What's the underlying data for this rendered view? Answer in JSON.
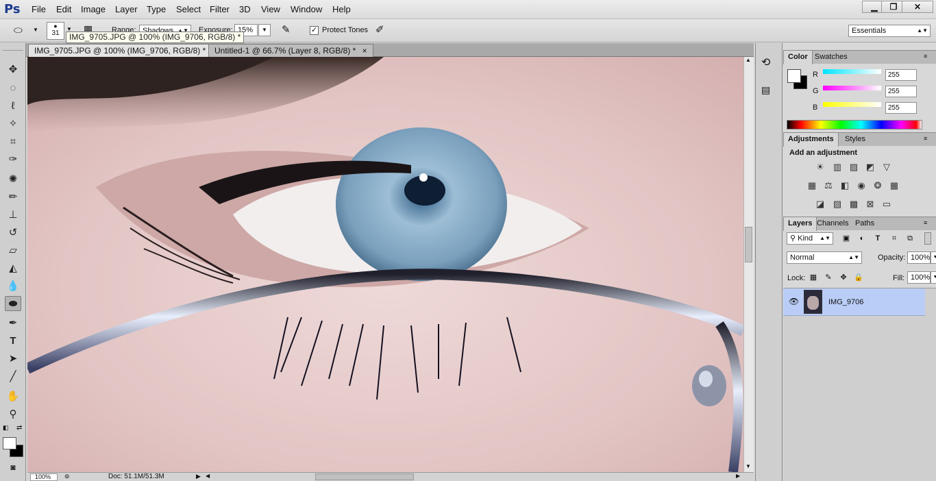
{
  "app": {
    "logo": "Ps"
  },
  "menu": [
    "File",
    "Edit",
    "Image",
    "Layer",
    "Type",
    "Select",
    "Filter",
    "3D",
    "View",
    "Window",
    "Help"
  ],
  "window_controls": {
    "minimize": "▁",
    "restore": "❐",
    "close": "✕"
  },
  "options": {
    "brush_size": "31",
    "range_label": "Range:",
    "range_value": "Shadows",
    "exposure_label": "Exposure:",
    "exposure_value": "15%",
    "protect_tones_label": "Protect Tones",
    "protect_tones_checked": true,
    "workspace": "Essentials",
    "tooltip": "IMG_9705.JPG @ 100% (IMG_9706, RGB/8) *"
  },
  "tabs": [
    {
      "label": "IMG_9705.JPG @ 100% (IMG_9706, RGB/8) *",
      "active": true
    },
    {
      "label": "Untitled-1 @ 66.7% (Layer 8, RGB/8) *",
      "active": false
    }
  ],
  "status": {
    "zoom": "100%",
    "doc": "Doc: 51.1M/51.3M"
  },
  "color_panel": {
    "tabs": [
      "Color",
      "Swatches"
    ],
    "channels": [
      {
        "name": "R",
        "value": "255",
        "color": "#00e5ff"
      },
      {
        "name": "G",
        "value": "255",
        "color": "#ff00ff"
      },
      {
        "name": "B",
        "value": "255",
        "color": "#ffff00"
      }
    ]
  },
  "adjustments_panel": {
    "tabs": [
      "Adjustments",
      "Styles"
    ],
    "heading": "Add an adjustment"
  },
  "layers_panel": {
    "tabs": [
      "Layers",
      "Channels",
      "Paths"
    ],
    "filter_kind": "Kind",
    "blend_mode": "Normal",
    "opacity_label": "Opacity:",
    "opacity_value": "100%",
    "lock_label": "Lock:",
    "fill_label": "Fill:",
    "fill_value": "100%",
    "layers": [
      {
        "name": "IMG_9706",
        "visible": true,
        "selected": true
      }
    ]
  },
  "colors": {
    "accent_selected_layer": "#b9cdf6",
    "chrome": "#d6d6d6"
  }
}
